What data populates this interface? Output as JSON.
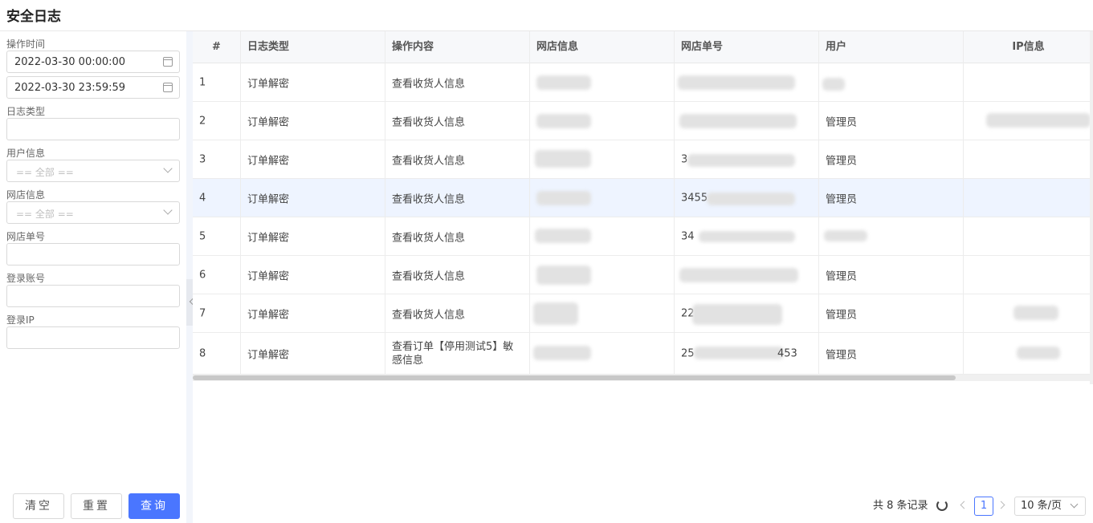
{
  "page": {
    "title": "安全日志"
  },
  "filters": {
    "op_time_label": "操作时间",
    "op_time_start": "2022-03-30 00:00:00",
    "op_time_end": "2022-03-30 23:59:59",
    "log_type_label": "日志类型",
    "user_label": "用户信息",
    "user_placeholder": "== 全部 ==",
    "shop_label": "网店信息",
    "shop_placeholder": "== 全部 ==",
    "order_label": "网店单号",
    "account_label": "登录账号",
    "ip_label": "登录IP"
  },
  "buttons": {
    "clear": "清空",
    "reset": "重置",
    "query": "查询"
  },
  "table": {
    "columns": [
      "#",
      "日志类型",
      "操作内容",
      "网店信息",
      "网店单号",
      "用户",
      "IP信息"
    ],
    "rows": [
      {
        "no": "1",
        "type": "订单解密",
        "content": "查看收货人信息",
        "order": "",
        "user": ""
      },
      {
        "no": "2",
        "type": "订单解密",
        "content": "查看收货人信息",
        "order": "",
        "user": "管理员"
      },
      {
        "no": "3",
        "type": "订单解密",
        "content": "查看收货人信息",
        "order": "3",
        "user": "管理员"
      },
      {
        "no": "4",
        "type": "订单解密",
        "content": "查看收货人信息",
        "order": "3455",
        "user": "管理员"
      },
      {
        "no": "5",
        "type": "订单解密",
        "content": "查看收货人信息",
        "order": "34",
        "user": ""
      },
      {
        "no": "6",
        "type": "订单解密",
        "content": "查看收货人信息",
        "order": "",
        "user": "管理员"
      },
      {
        "no": "7",
        "type": "订单解密",
        "content": "查看收货人信息",
        "order": "22",
        "user": "管理员"
      },
      {
        "no": "8",
        "type": "订单解密",
        "content": "查看订单【停用测试5】敏感信息",
        "order": "25",
        "order_tail": "453",
        "user": "管理员"
      }
    ]
  },
  "pagination": {
    "total": "共 8 条记录",
    "current_page": "1",
    "page_size": "10 条/页"
  },
  "colors": {
    "primary": "#4a76ff",
    "row_highlight": "#eef4ff"
  }
}
